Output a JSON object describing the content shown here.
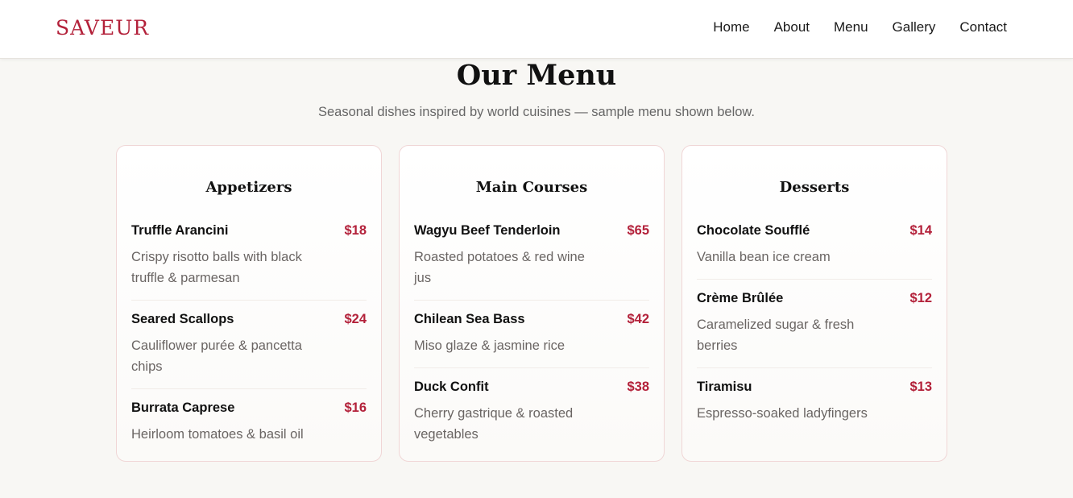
{
  "brand": {
    "logo": "SAVEUR",
    "accent": "#b3213a"
  },
  "nav": [
    {
      "label": "Home"
    },
    {
      "label": "About"
    },
    {
      "label": "Menu"
    },
    {
      "label": "Gallery"
    },
    {
      "label": "Contact"
    }
  ],
  "page": {
    "title": "Our Menu",
    "subtitle": "Seasonal dishes inspired by world cuisines — sample menu shown below."
  },
  "sections": [
    {
      "title": "Appetizers",
      "items": [
        {
          "name": "Truffle Arancini",
          "price": "$18",
          "desc": "Crispy risotto balls with black truffle & parmesan"
        },
        {
          "name": "Seared Scallops",
          "price": "$24",
          "desc": "Cauliflower purée & pancetta chips"
        },
        {
          "name": "Burrata Caprese",
          "price": "$16",
          "desc": "Heirloom tomatoes & basil oil"
        }
      ]
    },
    {
      "title": "Main Courses",
      "items": [
        {
          "name": "Wagyu Beef Tenderloin",
          "price": "$65",
          "desc": "Roasted potatoes & red wine jus"
        },
        {
          "name": "Chilean Sea Bass",
          "price": "$42",
          "desc": "Miso glaze & jasmine rice"
        },
        {
          "name": "Duck Confit",
          "price": "$38",
          "desc": "Cherry gastrique & roasted vegetables"
        }
      ]
    },
    {
      "title": "Desserts",
      "items": [
        {
          "name": "Chocolate Soufflé",
          "price": "$14",
          "desc": "Vanilla bean ice cream"
        },
        {
          "name": "Crème Brûlée",
          "price": "$12",
          "desc": "Caramelized sugar & fresh berries"
        },
        {
          "name": "Tiramisu",
          "price": "$13",
          "desc": "Espresso-soaked ladyfingers"
        }
      ]
    }
  ]
}
